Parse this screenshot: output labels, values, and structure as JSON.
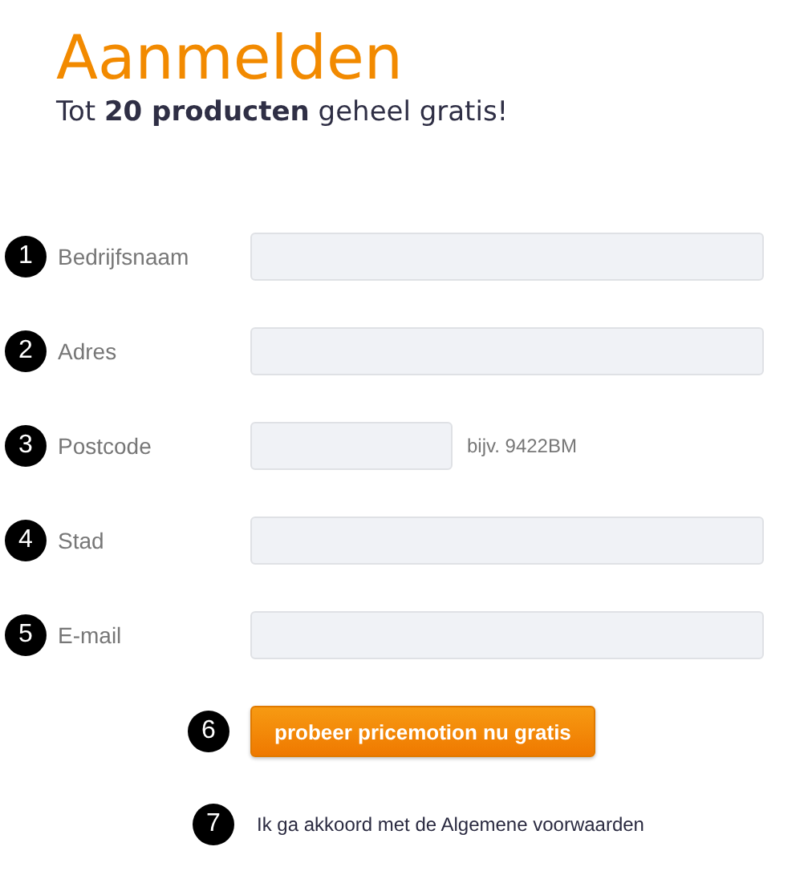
{
  "title": "Aanmelden",
  "subtitle": "Tot **20 producten** geheel gratis!",
  "fields": [
    {
      "marker": "1",
      "label": "Bedrijfsnaam",
      "kind": "wide"
    },
    {
      "marker": "2",
      "label": "Adres",
      "kind": "wide"
    },
    {
      "marker": "3",
      "label": "Postcode",
      "kind": "short",
      "hint": "bijv. 9422BM"
    },
    {
      "marker": "4",
      "label": "Stad",
      "kind": "wide"
    },
    {
      "marker": "5",
      "label": "E-mail",
      "kind": "wide"
    }
  ],
  "submit": {
    "marker": "6",
    "label": "probeer pricemotion nu gratis"
  },
  "terms": {
    "marker": "7",
    "text": "Ik ga akkoord met de Algemene voorwaarden"
  }
}
